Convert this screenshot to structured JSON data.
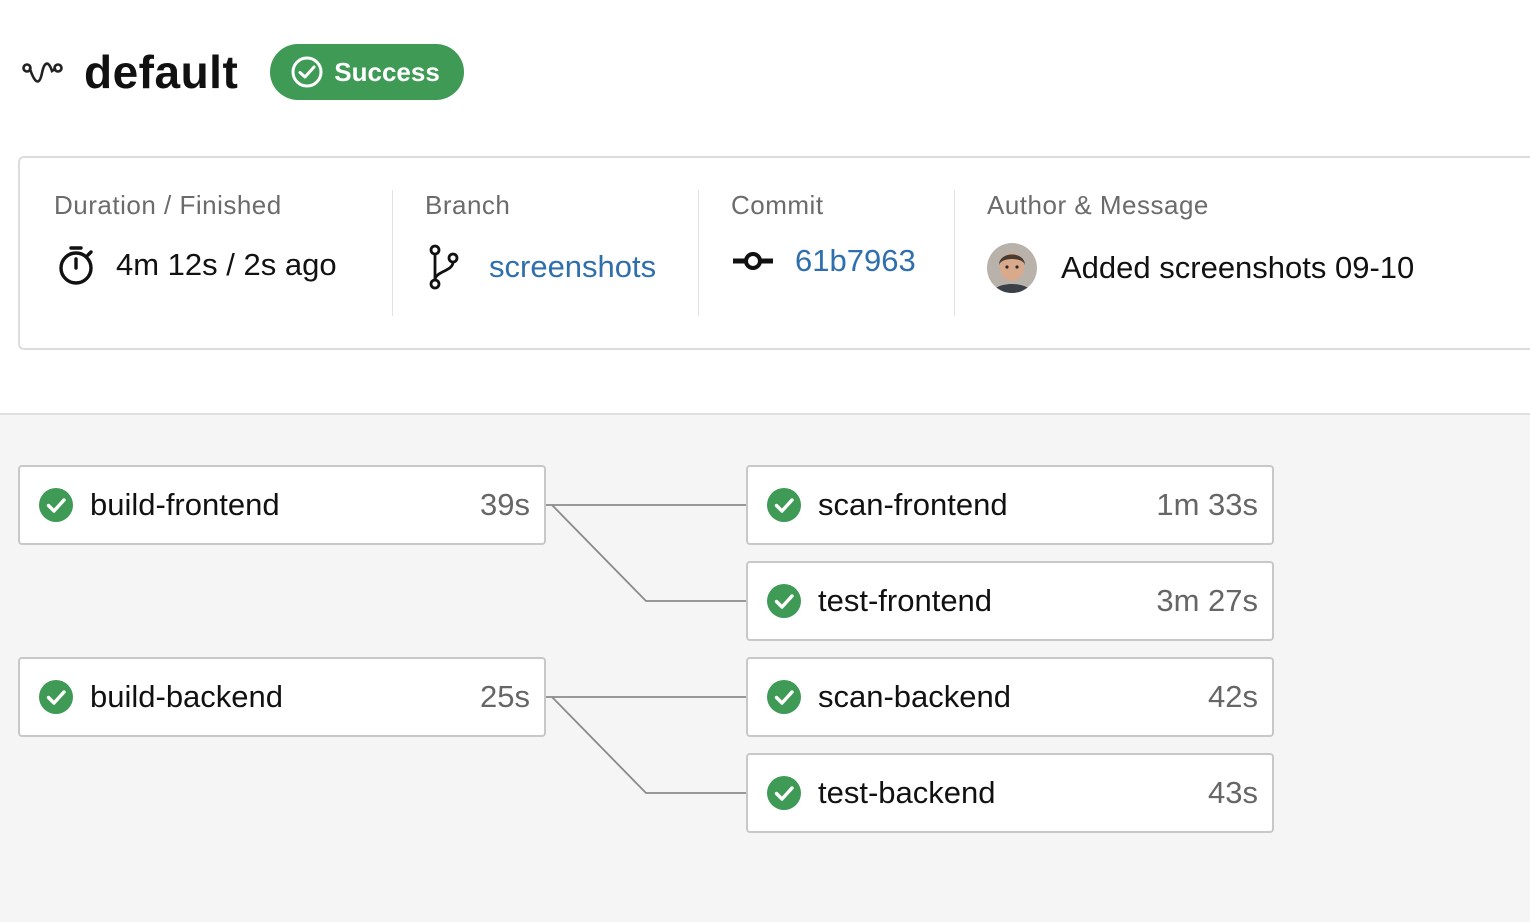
{
  "header": {
    "title": "default",
    "status": "Success"
  },
  "info": {
    "duration": {
      "label": "Duration / Finished",
      "value": "4m 12s / 2s ago"
    },
    "branch": {
      "label": "Branch",
      "value": "screenshots"
    },
    "commit": {
      "label": "Commit",
      "value": "61b7963"
    },
    "author": {
      "label": "Author & Message",
      "value": "Added screenshots 09-10"
    }
  },
  "jobs": [
    {
      "name": "build-frontend",
      "duration": "39s",
      "status": "success"
    },
    {
      "name": "build-backend",
      "duration": "25s",
      "status": "success"
    },
    {
      "name": "scan-frontend",
      "duration": "1m 33s",
      "status": "success"
    },
    {
      "name": "test-frontend",
      "duration": "3m 27s",
      "status": "success"
    },
    {
      "name": "scan-backend",
      "duration": "42s",
      "status": "success"
    },
    {
      "name": "test-backend",
      "duration": "43s",
      "status": "success"
    }
  ],
  "colors": {
    "success": "#3f9a55",
    "link": "#2f6fae"
  },
  "icons": {
    "pipeline": "pipeline-icon",
    "status": "check-circle-icon",
    "duration": "stopwatch-icon",
    "branch": "git-branch-icon",
    "commit": "git-commit-icon"
  }
}
